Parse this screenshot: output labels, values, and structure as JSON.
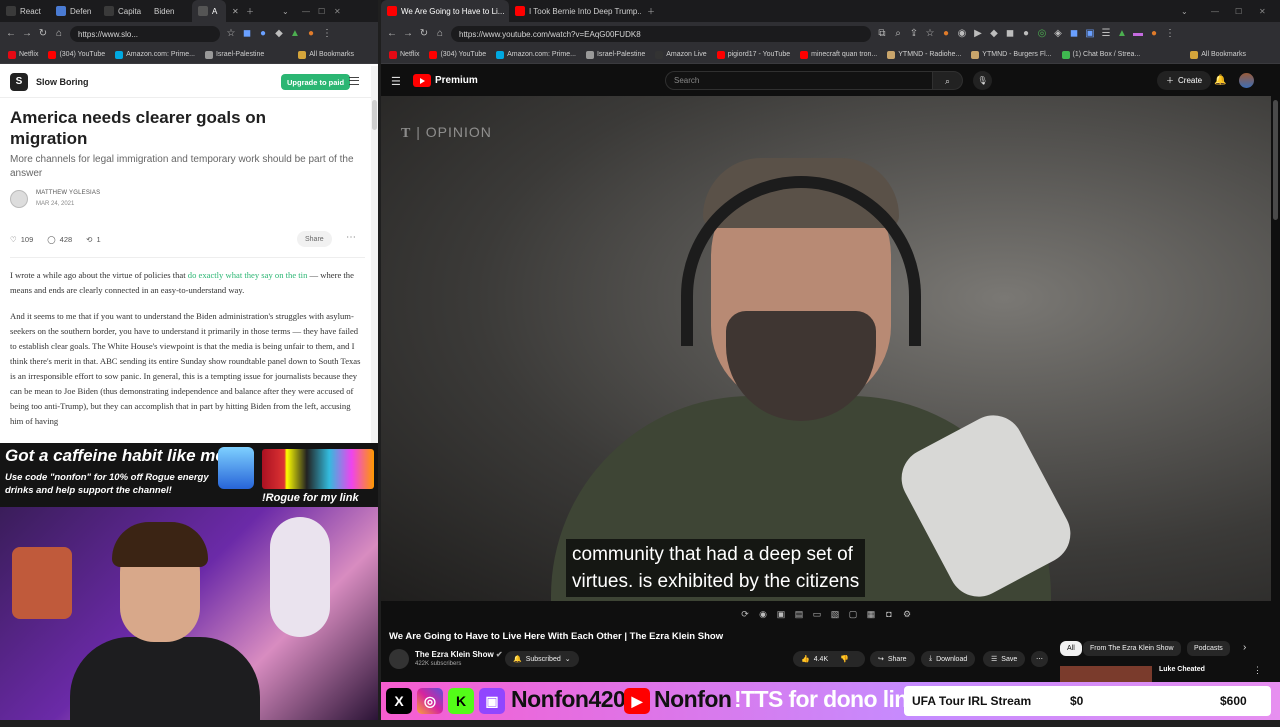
{
  "left_browser": {
    "tabs": [
      "React",
      "Defen",
      "Capita",
      "Biden",
      "A"
    ],
    "url": "https://www.slo...",
    "bookmarks": [
      "Netflix",
      "(304) YouTube",
      "Amazon.com: Prime...",
      "Israel-Palestine"
    ],
    "all_bookmarks": "All Bookmarks",
    "article": {
      "publication": "Slow Boring",
      "upgrade_label": "Upgrade to paid",
      "title": "America needs clearer goals on migration",
      "subtitle": "More channels for legal immigration and temporary work should be part of the answer",
      "author": "MATTHEW YGLESIAS",
      "date": "MAR 24, 2021",
      "likes": "109",
      "comments": "428",
      "restacks": "1",
      "share_label": "Share",
      "p1_before": "I wrote a while ago about the virtue of policies that ",
      "p1_link": "do exactly what they say on the tin",
      "p1_after": " — where the means and ends are clearly connected in an easy-to-understand way.",
      "p2": "And it seems to me that if you want to understand the Biden administration's struggles with asylum-seekers on the southern border, you have to understand it primarily in those terms — they have failed to establish clear goals. The White House's viewpoint is that the media is being unfair to them, and I think there's merit in that. ABC sending its entire Sunday show roundtable panel down to South Texas is an irresponsible effort to sow panic. In general, this is a tempting issue for journalists because they can be mean to Joe Biden (thus demonstrating independence and balance after they were accused of being too anti-Trump), but they can accomplish that in part by hitting Biden from the left, accusing him of having"
    }
  },
  "ad": {
    "headline": "Got a caffeine habit like me?",
    "body": "Use code \"nonfon\" for 10% off Rogue energy drinks and help support the channel!",
    "command": "!Rogue for my link"
  },
  "right_browser": {
    "tabs": [
      "We Are Going to Have to Li...",
      "I Took Bernie Into Deep Trump..."
    ],
    "url": "https://www.youtube.com/watch?v=EAqG00FUDK8",
    "bookmarks": [
      "Netflix",
      "(304) YouTube",
      "Amazon.com: Prime...",
      "Israel-Palestine",
      "Amazon Live",
      "pigiord17 - YouTube",
      "minecraft quan tron...",
      "YTMND - Radiohe...",
      "YTMND - Burgers Fl...",
      "(1) Chat Box / Strea..."
    ],
    "all_bookmarks": "All Bookmarks",
    "youtube": {
      "logo_text": "Premium",
      "search_placeholder": "Search",
      "create_label": "Create",
      "watermark": "OPINION",
      "caption_line1": "community that had a deep set of",
      "caption_line2": "virtues. is exhibited by the citizens",
      "video_title": "We Are Going to Have to Live Here With Each Other | The Ezra Klein Show",
      "channel_name": "The Ezra Klein Show",
      "subscribers": "422K subscribers",
      "subscribed_label": "Subscribed",
      "likes": "4.4K",
      "share_label": "Share",
      "download_label": "Download",
      "save_label": "Save",
      "chips": [
        "All",
        "From The Ezra Klein Show",
        "Podcasts"
      ],
      "rec_title": "Luke Cheated"
    }
  },
  "stream_bar": {
    "handle1": "Nonfon420",
    "handle2": "Nonfon",
    "tts": "!TTS for dono link",
    "goal_label": "UFA Tour IRL Stream",
    "goal_current": "$0",
    "goal_target": "$600"
  },
  "colors": {
    "accent_green": "#2bb673",
    "youtube_red": "#ff0000",
    "stream_pink": "#f75dd0"
  }
}
